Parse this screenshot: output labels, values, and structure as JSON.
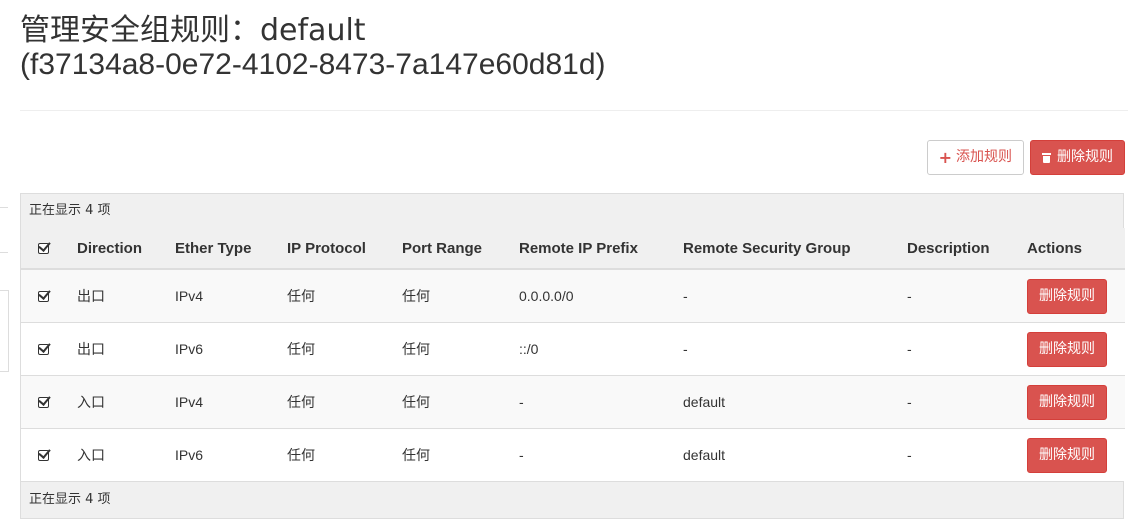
{
  "page": {
    "title_line1": "管理安全组规则：default",
    "title_line2": "(f37134a8-0e72-4102-8473-7a147e60d81d)"
  },
  "toolbar": {
    "add_label": "添加规则",
    "delete_label": "删除规则"
  },
  "table": {
    "count_top": "正在显示 4 项",
    "count_bottom": "正在显示 4 项",
    "headers": [
      "Direction",
      "Ether Type",
      "IP Protocol",
      "Port Range",
      "Remote IP Prefix",
      "Remote Security Group",
      "Description",
      "Actions"
    ],
    "rows": [
      {
        "direction": "出口",
        "ether": "IPv4",
        "protocol": "任何",
        "port": "任何",
        "prefix": "0.0.0.0/0",
        "group": "-",
        "desc": "-",
        "action": "删除规则"
      },
      {
        "direction": "出口",
        "ether": "IPv6",
        "protocol": "任何",
        "port": "任何",
        "prefix": "::/0",
        "group": "-",
        "desc": "-",
        "action": "删除规则"
      },
      {
        "direction": "入口",
        "ether": "IPv4",
        "protocol": "任何",
        "port": "任何",
        "prefix": "-",
        "group": "default",
        "desc": "-",
        "action": "删除规则"
      },
      {
        "direction": "入口",
        "ether": "IPv6",
        "protocol": "任何",
        "port": "任何",
        "prefix": "-",
        "group": "default",
        "desc": "-",
        "action": "删除规则"
      }
    ]
  },
  "colors": {
    "danger": "#d9534f",
    "border": "#dddddd",
    "header_bg": "#f0f0f0"
  },
  "icons": [
    "plus-icon",
    "trash-icon",
    "checkbox-checked-icon"
  ]
}
